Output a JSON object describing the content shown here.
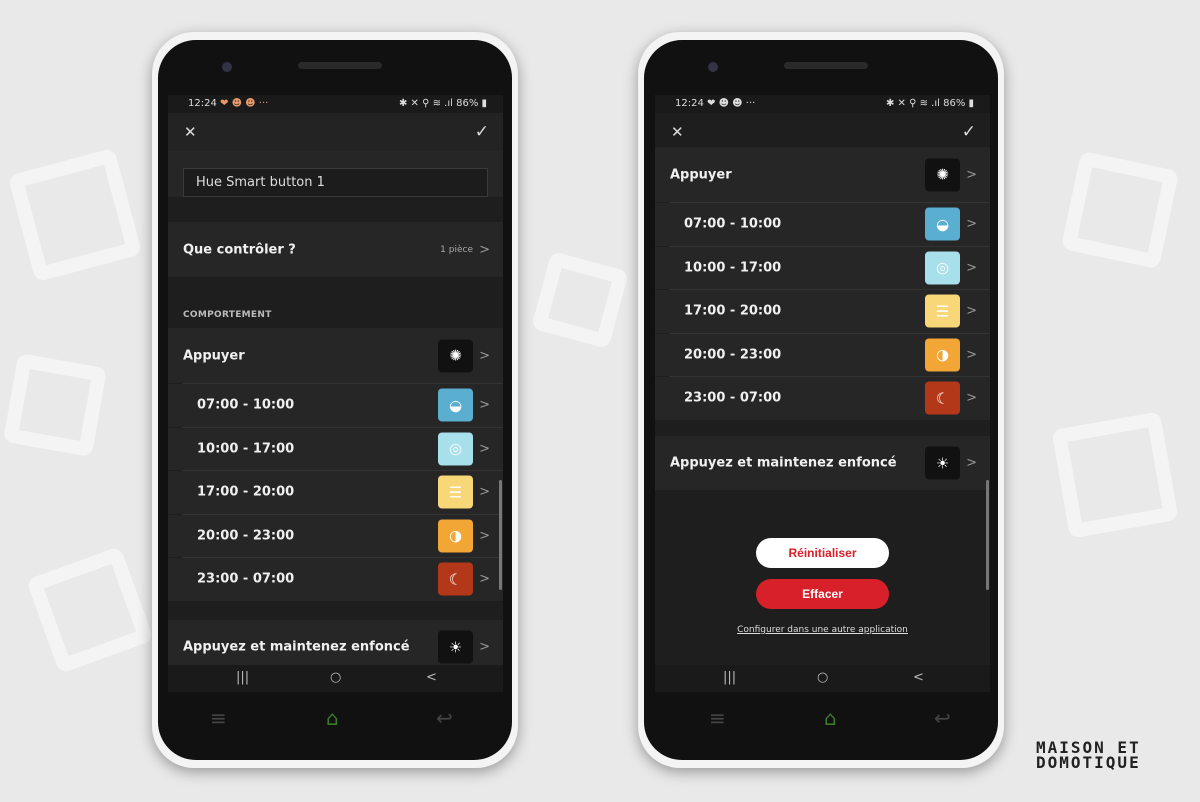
{
  "status_bar": {
    "time": "12:24",
    "notif_icons": "❤ ☻ ☻ ···",
    "right": "✱ ✕ ⚲ ≋ .ıl 86% ▮"
  },
  "toolbar": {
    "close_icon": "✕",
    "confirm_icon": "✓"
  },
  "left_screen": {
    "name_input_value": "Hue Smart button 1",
    "control_row": {
      "label": "Que contrôler ?",
      "value": "1 pièce"
    },
    "section_title": "COMPORTEMENT"
  },
  "press": {
    "label": "Appuyer",
    "icon": "scene-press-icon"
  },
  "time_slots": [
    {
      "label": "07:00 - 10:00",
      "icon": "◒",
      "color": "#5aaed0"
    },
    {
      "label": "10:00 - 17:00",
      "icon": "◎",
      "color": "#a7dfea"
    },
    {
      "label": "17:00 - 20:00",
      "icon": "☰",
      "color": "#f7d778"
    },
    {
      "label": "20:00 - 23:00",
      "icon": "◑",
      "color": "#f2a636"
    },
    {
      "label": "23:00 - 07:00",
      "icon": "☾",
      "color": "#b3381a"
    }
  ],
  "hold": {
    "label": "Appuyez et maintenez enfoncé",
    "icon": "brightness-icon"
  },
  "right_screen": {
    "reset_button": "Réinitialiser",
    "delete_button": "Effacer",
    "other_app_link": "Configurer dans une autre application"
  },
  "nav": {
    "recents": "|||",
    "home": "○",
    "back": "<"
  },
  "app_bar": {
    "menu": "≡",
    "home": "⌂",
    "back": "↩"
  },
  "colors": {
    "accent_red": "#d8202a",
    "home_green": "#3a7a2a"
  },
  "watermark": {
    "line1": "MAISON ET",
    "line2": "DOMOTIQUE"
  }
}
